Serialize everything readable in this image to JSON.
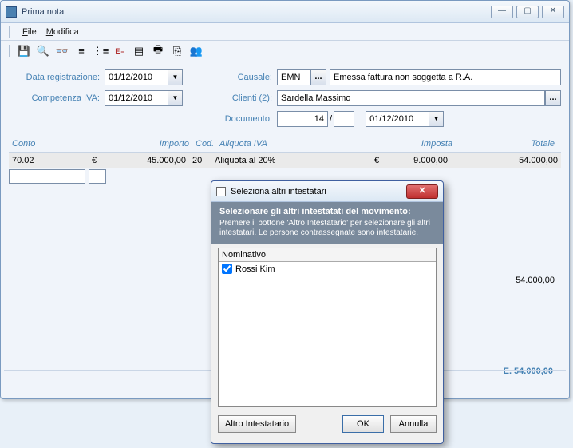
{
  "window": {
    "title": "Prima nota",
    "min": "—",
    "max": "▢",
    "close": "✕"
  },
  "menu": {
    "file": "File",
    "file_u": "F",
    "modifica": "Modifica",
    "modifica_u": "M"
  },
  "toolbar": {
    "save": "💾",
    "find": "🔍",
    "glasses": "👓",
    "list": "≡",
    "list2": "⋮≡",
    "eq": "E=",
    "doc": "▤",
    "print": "🖶",
    "copy": "⎘",
    "users": "👥"
  },
  "form": {
    "data_reg_lbl": "Data registrazione:",
    "data_reg_val": "01/12/2010",
    "comp_iva_lbl": "Competenza IVA:",
    "comp_iva_val": "01/12/2010",
    "causale_lbl": "Causale:",
    "causale_code": "EMN",
    "causale_desc": "Emessa fattura non soggetta a R.A.",
    "clienti_lbl": "Clienti (2):",
    "clienti_val": "Sardella Massimo",
    "documento_lbl": "Documento:",
    "doc_num": "14",
    "doc_sep": "/",
    "doc_sub": "",
    "doc_date": "01/12/2010",
    "dots": "..."
  },
  "grid": {
    "headers": {
      "conto": "Conto",
      "importo": "Importo",
      "cod": "Cod.",
      "aliquota": "Aliquota IVA",
      "imposta": "Imposta",
      "totale": "Totale"
    },
    "row": {
      "conto": "70.02",
      "eur1": "€",
      "importo": "45.000,00",
      "cod": "20",
      "aliquota": "Aliquota al 20%",
      "eur2": "€",
      "imposta": "9.000,00",
      "totale": "54.000,00"
    },
    "total_right": "54.000,00",
    "bottom_total": "E. 54.000,00"
  },
  "dialog": {
    "title": "Seleziona altri intestatari",
    "close": "✕",
    "header": "Selezionare gli altri intestatati del movimento:",
    "sub": "Premere il bottone 'Altro Intestatario' per selezionare gli altri intestatari. Le persone contrassegnate sono intestatarie.",
    "col": "Nominativo",
    "item": "Rossi Kim",
    "btn_altro": "Altro Intestatario",
    "btn_ok": "OK",
    "btn_annulla": "Annulla"
  }
}
